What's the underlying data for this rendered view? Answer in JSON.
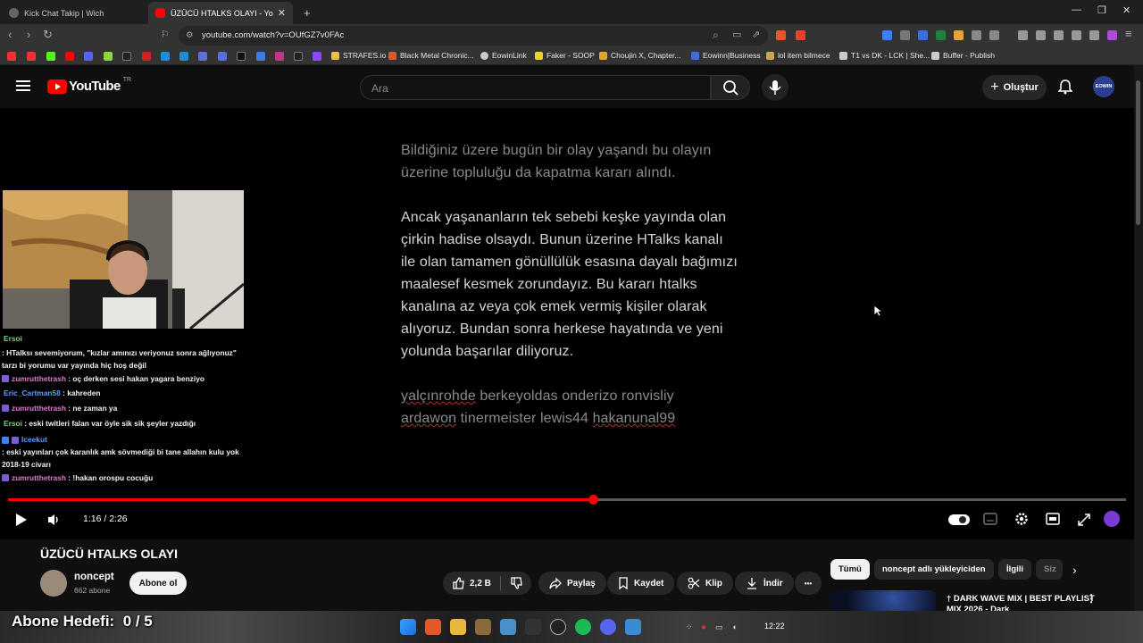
{
  "browser": {
    "tabs": [
      {
        "label": "Kick Chat Takip | Wich",
        "active": false
      },
      {
        "label": "ÜZÜCÜ HTALKS OLAYI - YouTube",
        "active": true
      }
    ],
    "new_tab": "+",
    "url": "youtube.com/watch?v=OUfGZ7v0FAc",
    "bookmarks": [
      "STRAFES.io",
      "Black Metal Chronic...",
      "EowinLink",
      "Faker - SOOP",
      "Choujin X, Chapter...",
      "Eowinn|Business",
      "lol item bilmece",
      "T1 vs DK - LCK | She...",
      "Buffer - Publish"
    ]
  },
  "youtube": {
    "logo": "YouTube",
    "region": "TR",
    "search_placeholder": "Ara",
    "create_label": "Oluştur",
    "avatar_text": "EOWIN"
  },
  "video": {
    "paragraph1": "Bildiğiniz üzere bugün bir olay yaşandı bu olayın üzerine topluluğu da kapatma kararı alındı.",
    "paragraph2": "Ancak yaşananların tek sebebi keşke yayında olan çirkin hadise olsaydı. Bunun üzerine HTalks kanalı ile olan tamamen gönüllülük esasına dayalı bağımızı maalesef kesmek zorundayız. Bu kararı htalks kanalına az veya çok emek vermiş kişiler olarak alıyoruz. Bundan sonra herkese hayatında ve yeni yolunda başarılar diliyoruz.",
    "names_line1": [
      "yalçınrohde",
      "berkeyoldas",
      "onderizo",
      "ronvisliy"
    ],
    "names_line2": [
      "ardawon",
      "tinermeister",
      "lewis44",
      "hakanunal99"
    ],
    "time_current": "1:16",
    "time_total": "2:26",
    "progress": 0.523
  },
  "stream_chat": [
    {
      "user": "Ersoi",
      "color": "#7ad27a",
      "text": ": HTalksı sevemiyorum, \"kızlar amınızı veriyonuz sonra ağlıyonuz\" tarzı bi yorumu var yayında hiç hoş değil"
    },
    {
      "user": "zumrutthetrash",
      "color": "#e07ad0",
      "text": ": oç derken sesi hakan yagara benziyo"
    },
    {
      "user": "Eric_Cartman58",
      "color": "#5aa0ff",
      "text": ": kahreden"
    },
    {
      "user": "zumrutthetrash",
      "color": "#e07ad0",
      "text": ": ne zaman ya"
    },
    {
      "user": "Ersoi",
      "color": "#7ad27a",
      "text": ": eski twitleri falan var öyle sik sik şeyler yazdığı"
    },
    {
      "user": "Iceekut",
      "color": "#5aa0ff",
      "text": ": eski yayınları çok karanlık amk sövmediği bi tane allahın kulu yok 2018-19 civarı"
    },
    {
      "user": "zumrutthetrash",
      "color": "#e07ad0",
      "text": ": !hakan orospu cocuğu"
    }
  ],
  "watch": {
    "title": "ÜZÜCÜ HTALKS OLAYI",
    "channel": "noncept",
    "subscribers": "662 abone",
    "subscribe_label": "Abone ol",
    "likes": "2,2 B",
    "share_label": "Paylaş",
    "save_label": "Kaydet",
    "clip_label": "Klip",
    "download_label": "İndir",
    "more_label": "•••"
  },
  "chips": [
    "Tümü",
    "noncept adlı yükleyiciden",
    "İlgili",
    "Siz"
  ],
  "recommendation": {
    "title": "† DARK WAVE MIX | BEST PLAYLIST MIX 2026 - Dark"
  },
  "overlay": {
    "goal_label": "Abone Hedefi:",
    "goal_value": "0 / 5"
  },
  "taskbar": {
    "clock": "12:22"
  },
  "colors": {
    "accent": "#ff0000",
    "background": "#0f0f0f"
  }
}
